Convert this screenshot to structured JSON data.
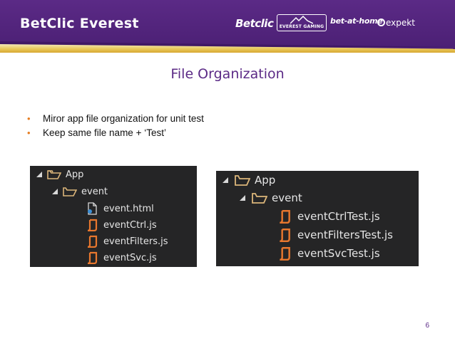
{
  "header": {
    "company": "BetClic Everest",
    "brands": {
      "betclic": "Betclic",
      "everest_gaming": "EVEREST GAMING",
      "bet_at_home": "bet-at-home",
      "expekt": "expekt"
    }
  },
  "slide": {
    "title": "File Organization",
    "bullets": [
      "Miror app file organization for unit test",
      "Keep same file name + ‘Test’"
    ],
    "page_number": "6"
  },
  "left_tree": {
    "root": "App",
    "folder": "event",
    "files": [
      "event.html",
      "eventCtrl.js",
      "eventFilters.js",
      "eventSvc.js"
    ]
  },
  "right_tree": {
    "root": "App",
    "folder": "event",
    "files": [
      "eventCtrlTest.js",
      "eventFiltersTest.js",
      "eventSvcTest.js"
    ]
  },
  "colors": {
    "header_purple": "#5b2a86",
    "header_gold": "#e9c95a",
    "title_purple": "#5b2a86",
    "bullet_orange": "#e67e22",
    "tree_background": "#252526",
    "folder_icon": "#dcb67a",
    "js_icon": "#e8772e"
  }
}
